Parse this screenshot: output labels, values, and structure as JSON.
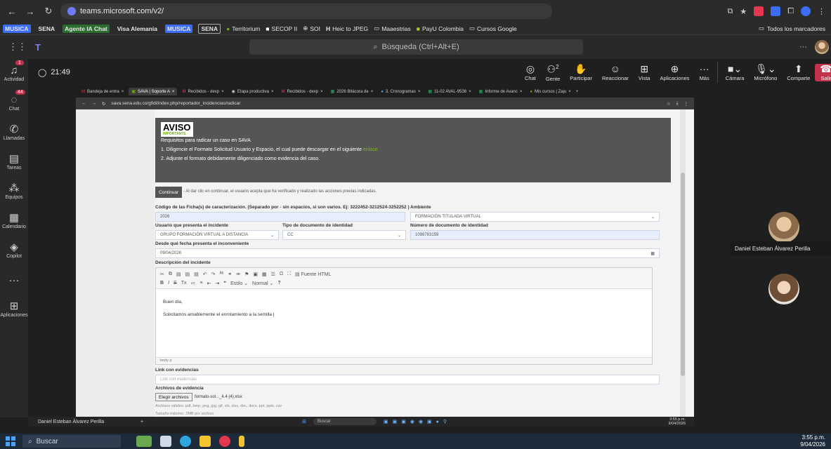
{
  "browser": {
    "url": "teams.microsoft.com/v2/",
    "bookmarks": [
      "MUSICA",
      "SENA",
      "Agente IA Chat",
      "Visa Alemania",
      "MUSICA",
      "SENA",
      "Territorium",
      "SECOP II",
      "SOI",
      "Heic to JPEG",
      "Maaestrias",
      "PayU Colombia",
      "Cursos Google"
    ],
    "all_bookmarks": "Todos los marcadores"
  },
  "teams": {
    "search_placeholder": "Búsqueda (Ctrl+Alt+E)",
    "rail": [
      {
        "label": "Actividad",
        "icon": "bell-icon",
        "badge": "1"
      },
      {
        "label": "Chat",
        "icon": "chat-icon",
        "badge": "44"
      },
      {
        "label": "Llamadas",
        "icon": "phone-icon",
        "badge": ""
      },
      {
        "label": "Tareas",
        "icon": "clipboard-icon",
        "badge": ""
      },
      {
        "label": "Equipos",
        "icon": "teams-icon",
        "badge": ""
      },
      {
        "label": "Calendario",
        "icon": "calendar-icon",
        "badge": ""
      },
      {
        "label": "Copilot",
        "icon": "copilot-icon",
        "badge": ""
      },
      {
        "label": "",
        "icon": "more-icon",
        "badge": ""
      },
      {
        "label": "Aplicaciones",
        "icon": "apps-icon",
        "badge": ""
      }
    ],
    "timer": "21:49",
    "controls": {
      "chat": "Chat",
      "people": "Gente",
      "people_count": "2",
      "raise": "Participar",
      "react": "Reaccionar",
      "view": "Vista",
      "apps": "Aplicaciones",
      "more": "Más",
      "camera": "Cámara",
      "mic": "Micrófono",
      "share": "Comparte",
      "leave": "Salir"
    },
    "participant_name": "Daniel Esteban Álvarez Perilla"
  },
  "shared": {
    "tabs": [
      "Bandeja de entra",
      "SAVA | Soporte A",
      "Recibidos - dexp",
      "Etapa productiva",
      "Recibidos - dexp",
      "2026 Bitácora de",
      "3. Cronogramas",
      "11-02 AVAL-9538",
      "Informe de Avanc",
      "Mis cursos | Zaju"
    ],
    "url": "sava.sena.edu.co/gfidi/index.php/reportador_incidencias/radicar",
    "aviso": {
      "logo": "AVISO",
      "logo_sub": "IMPORTANTE",
      "line0": "Requisitos para radicar un caso en SAVA",
      "line1": "1. Diligencie el Formato Solicitud Usuario y Espacio, el cual puede descargar en el siguiente",
      "line1_link": "enlace",
      "line2": "2. Adjunte el formato debidamente diligenciado como evidencia del caso."
    },
    "continue_btn": "Continuar",
    "continue_note": "- Al dar clic en continuar, el usuario acepta que ha verificado y realizado las acciones previas indicadas.",
    "labels": {
      "ficha": "Código de las Ficha(s) de caracterización. (Separado por - sin espacios, si son varios. Ej: 3222452-3212524-3252252 )",
      "ambiente": "Ambiente",
      "usuario": "Usuario que presenta el incidente",
      "tipo_doc": "Tipo de documento de identidad",
      "num_doc": "Número de documento de identidad",
      "desde": "Desde qué fecha presenta el inconveniente",
      "descripcion": "Descripción del incidente",
      "link": "Link con evidencias",
      "archivos": "Archivos de evidencia"
    },
    "values": {
      "ficha": "2026",
      "ambiente": "FORMACIÓN TITULADA VIRTUAL",
      "usuario": "GRUPO FORMACIÓN VIRTUAL A DISTANCIA",
      "tipo_doc": "CC",
      "num_doc": "1098783159",
      "desde": "09/04/2026",
      "link_placeholder": "Link con evidencias"
    },
    "editor": {
      "toolbar_source": "Fuente HTML",
      "toolbar_style": "Estilo",
      "toolbar_format": "Normal",
      "line1": "Buen día,",
      "line2": "Solicitamos amablemente el enrolamiento a la semilla |",
      "footer": "body  p"
    },
    "file_btn": "Elegir archivos",
    "file_name": "formato-sol..._4.4 (4).xlsx",
    "allowed": "Archivos válidos: pdf, bmp, png, jpg, gif, xls, xlsx, doc, docx, ppt, pptx, csv",
    "max_size": "Tamaño máximo: 2MB por archivo",
    "inner_taskbar": {
      "name": "Daniel Esteban Álvarez Perilla",
      "search": "Buscar",
      "time": "3:55 p.m.",
      "date": "9/04/2026",
      "lang": "ESP\nLAA"
    }
  },
  "taskbar": {
    "search": "Buscar",
    "time": "3:55 p.m.",
    "date": "9/04/2026"
  }
}
